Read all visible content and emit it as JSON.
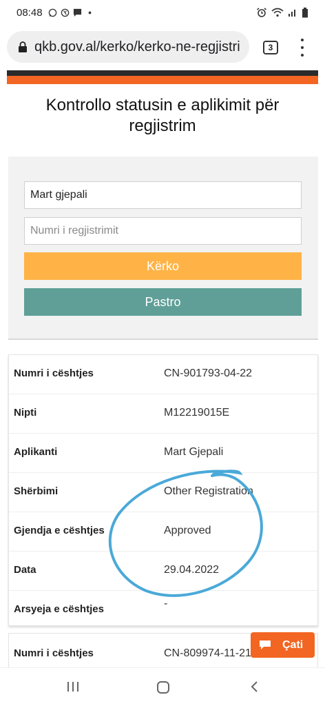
{
  "status_bar": {
    "time": "08:48"
  },
  "browser": {
    "url": "qkb.gov.al/kerko/kerko-ne-regjistri",
    "tab_count": "3"
  },
  "page": {
    "title": "Kontrollo statusin e aplikimit për regjistrim"
  },
  "search": {
    "name_value": "Mart gjepali",
    "reg_placeholder": "Numri i regjistrimit",
    "search_label": "Kërko",
    "clear_label": "Pastro"
  },
  "results": [
    {
      "rows": [
        {
          "label": "Numri i cështjes",
          "value": "CN-901793-04-22"
        },
        {
          "label": "Nipti",
          "value": "M12219015E"
        },
        {
          "label": "Aplikanti",
          "value": "Mart Gjepali"
        },
        {
          "label": "Shërbimi",
          "value": "Other Registration"
        },
        {
          "label": "Gjendja e cështjes",
          "value": "Approved"
        },
        {
          "label": "Data",
          "value": "29.04.2022"
        },
        {
          "label": "Arsyeja e cështjes",
          "value": "-"
        }
      ]
    },
    {
      "rows": [
        {
          "label": "Numri i cështjes",
          "value": "CN-809974-11-21"
        }
      ]
    }
  ],
  "chat": {
    "label": "Çati"
  },
  "colors": {
    "search_button": "#ffb347",
    "clear_button": "#5f9f97",
    "accent_orange": "#f26522",
    "annotation_circle": "#4aa9d8"
  }
}
